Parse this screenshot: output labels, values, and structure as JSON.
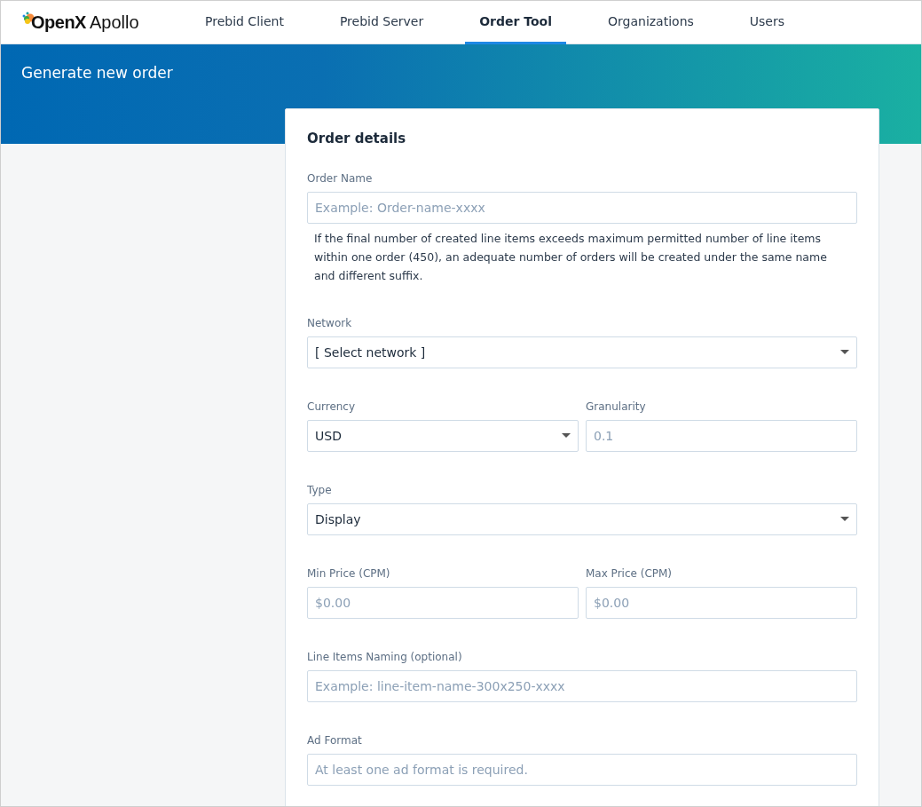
{
  "logo": {
    "brand": "OpenX",
    "product": "Apollo"
  },
  "nav": [
    {
      "label": "Prebid Client",
      "selected": false
    },
    {
      "label": "Prebid Server",
      "selected": false
    },
    {
      "label": "Order Tool",
      "selected": true
    },
    {
      "label": "Organizations",
      "selected": false
    },
    {
      "label": "Users",
      "selected": false
    }
  ],
  "page_title": "Generate new order",
  "card": {
    "title": "Order details",
    "rows": [
      {
        "fields": [
          {
            "label": "Order Name",
            "kind": "text",
            "placeholder": "Example: Order-name-xxxx",
            "hint": "If the final number of created line items exceeds maximum permitted number of line items within one order (450), an adequate number of orders will be created under the same name and different suffix."
          }
        ]
      },
      {
        "fields": [
          {
            "label": "Network",
            "kind": "select",
            "value": "[ Select network ]"
          }
        ]
      },
      {
        "fields": [
          {
            "label": "Currency",
            "kind": "select",
            "value": "USD"
          },
          {
            "label": "Granularity",
            "kind": "text",
            "placeholder": "0.1"
          }
        ]
      },
      {
        "fields": [
          {
            "label": "Type",
            "kind": "select",
            "value": "Display"
          }
        ]
      },
      {
        "fields": [
          {
            "label": "Min Price (CPM)",
            "kind": "text",
            "placeholder": "$0.00"
          },
          {
            "label": "Max Price (CPM)",
            "kind": "text",
            "placeholder": "$0.00"
          }
        ]
      },
      {
        "fields": [
          {
            "label": "Line Items Naming (optional)",
            "kind": "text",
            "placeholder": "Example: line-item-name-300x250-xxxx"
          }
        ]
      },
      {
        "fields": [
          {
            "label": "Ad Format",
            "kind": "text",
            "placeholder": "At least one ad format is required."
          }
        ]
      }
    ]
  }
}
